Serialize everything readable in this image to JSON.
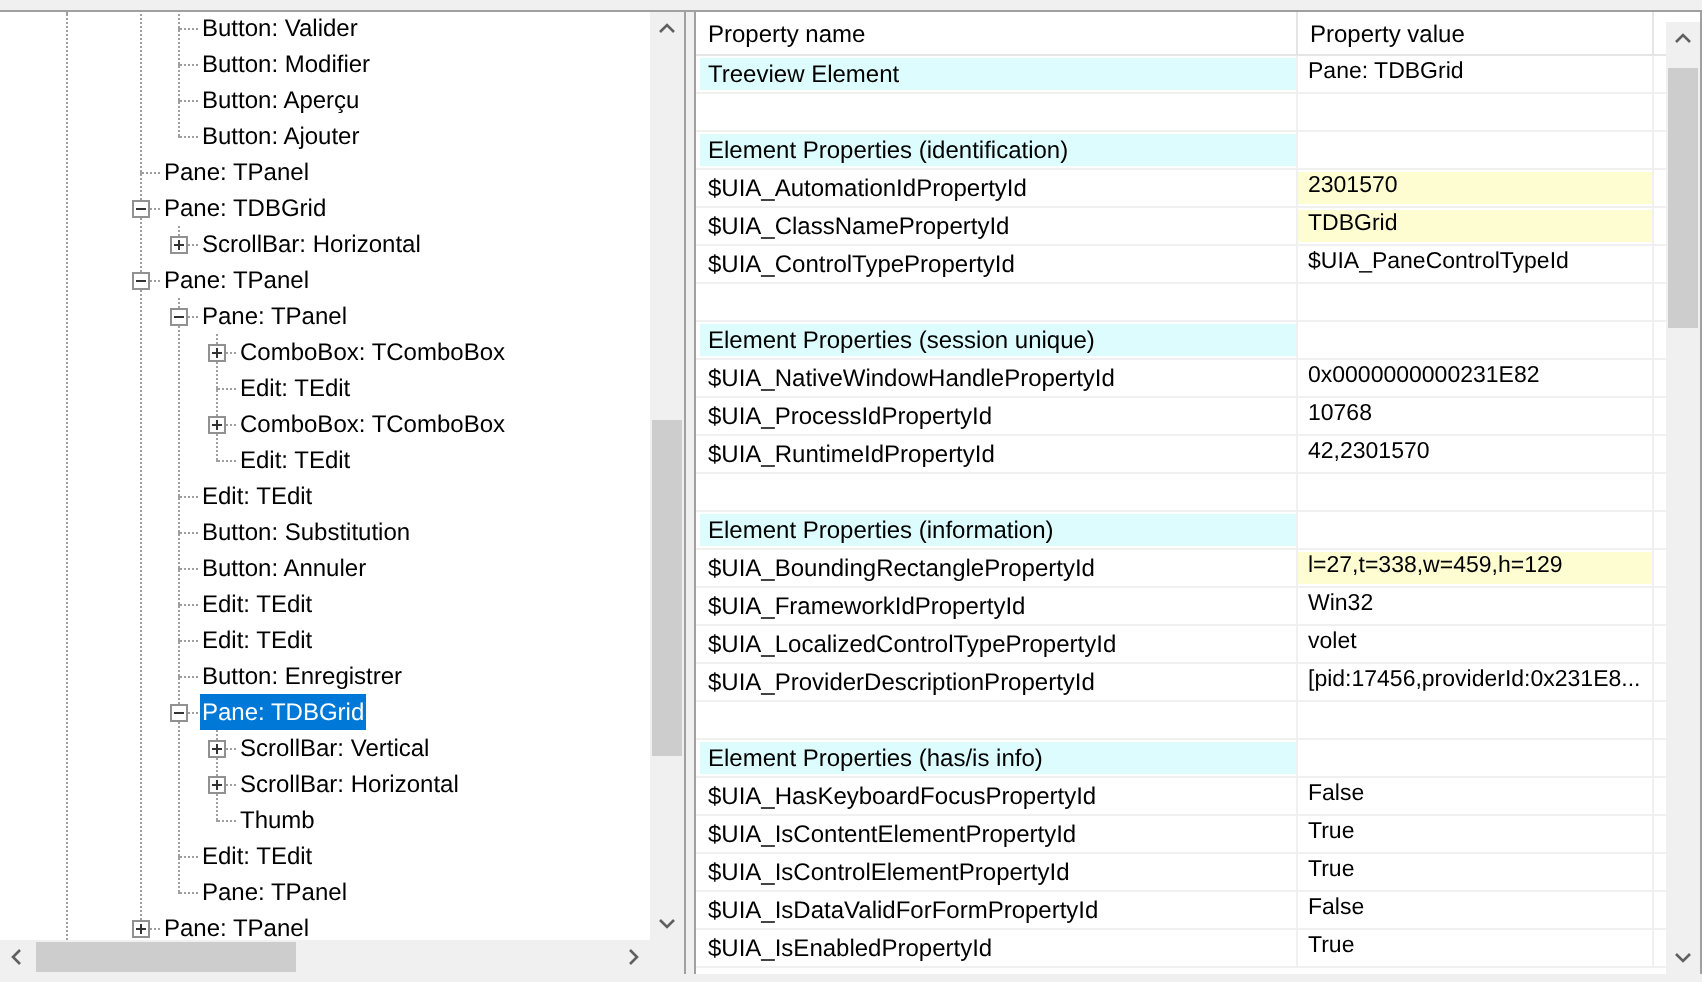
{
  "tree": {
    "items": [
      {
        "children": [
          {
            "label": "Button: Valider"
          },
          {
            "label": "Button: Modifier"
          },
          {
            "label": "Button: Aperçu"
          },
          {
            "label": "Button: Ajouter"
          }
        ]
      },
      {
        "label": "Pane: TPanel"
      },
      {
        "label": "Pane: TDBGrid",
        "expanded": true,
        "children": [
          {
            "label": "ScrollBar: Horizontal",
            "expanded": false
          }
        ]
      },
      {
        "label": "Pane: TPanel",
        "expanded": true,
        "children": [
          {
            "label": "Pane: TPanel",
            "expanded": true,
            "children": [
              {
                "label": "ComboBox: TComboBox",
                "expanded": false
              },
              {
                "label": "Edit: TEdit"
              },
              {
                "label": "ComboBox: TComboBox",
                "expanded": false
              },
              {
                "label": "Edit: TEdit"
              }
            ]
          },
          {
            "label": "Edit: TEdit"
          },
          {
            "label": "Button: Substitution"
          },
          {
            "label": "Button: Annuler"
          },
          {
            "label": "Edit: TEdit"
          },
          {
            "label": "Edit: TEdit"
          },
          {
            "label": "Button: Enregistrer"
          },
          {
            "label": "Pane: TDBGrid",
            "expanded": true,
            "selected": true,
            "children": [
              {
                "label": "ScrollBar: Vertical",
                "expanded": false
              },
              {
                "label": "ScrollBar: Horizontal",
                "expanded": false
              },
              {
                "label": "Thumb"
              }
            ]
          },
          {
            "label": "Edit: TEdit"
          },
          {
            "label": "Pane: TPanel"
          }
        ]
      },
      {
        "label": "Pane: TPanel",
        "expanded": false
      }
    ]
  },
  "properties": {
    "columns": [
      "Property name",
      "Property value"
    ],
    "rows": [
      {
        "kind": "element",
        "name": "Treeview Element",
        "value": "Pane: TDBGrid"
      },
      {
        "kind": "blank"
      },
      {
        "kind": "section",
        "name": "Element Properties (identification)"
      },
      {
        "kind": "property",
        "name": "$UIA_AutomationIdPropertyId",
        "value": "2301570",
        "highlighted": true
      },
      {
        "kind": "property",
        "name": "$UIA_ClassNamePropertyId",
        "value": "TDBGrid",
        "highlighted": true
      },
      {
        "kind": "property",
        "name": "$UIA_ControlTypePropertyId",
        "value": "$UIA_PaneControlTypeId",
        "highlighted": false
      },
      {
        "kind": "blank"
      },
      {
        "kind": "section",
        "name": "Element Properties (session unique)"
      },
      {
        "kind": "property",
        "name": "$UIA_NativeWindowHandlePropertyId",
        "value": "0x0000000000231E82",
        "highlighted": false
      },
      {
        "kind": "property",
        "name": "$UIA_ProcessIdPropertyId",
        "value": "10768",
        "highlighted": false
      },
      {
        "kind": "property",
        "name": "$UIA_RuntimeIdPropertyId",
        "value": "42,2301570",
        "highlighted": false
      },
      {
        "kind": "blank"
      },
      {
        "kind": "section",
        "name": "Element Properties (information)"
      },
      {
        "kind": "property",
        "name": "$UIA_BoundingRectanglePropertyId",
        "value": "l=27,t=338,w=459,h=129",
        "highlighted": true
      },
      {
        "kind": "property",
        "name": "$UIA_FrameworkIdPropertyId",
        "value": "Win32",
        "highlighted": false
      },
      {
        "kind": "property",
        "name": "$UIA_LocalizedControlTypePropertyId",
        "value": "volet",
        "highlighted": false
      },
      {
        "kind": "property",
        "name": "$UIA_ProviderDescriptionPropertyId",
        "value": "[pid:17456,providerId:0x231E8...",
        "highlighted": false
      },
      {
        "kind": "blank"
      },
      {
        "kind": "section",
        "name": "Element Properties (has/is info)"
      },
      {
        "kind": "property",
        "name": "$UIA_HasKeyboardFocusPropertyId",
        "value": "False",
        "highlighted": false
      },
      {
        "kind": "property",
        "name": "$UIA_IsContentElementPropertyId",
        "value": "True",
        "highlighted": false
      },
      {
        "kind": "property",
        "name": "$UIA_IsControlElementPropertyId",
        "value": "True",
        "highlighted": false
      },
      {
        "kind": "property",
        "name": "$UIA_IsDataValidForFormPropertyId",
        "value": "False",
        "highlighted": false
      },
      {
        "kind": "property",
        "name": "$UIA_IsEnabledPropertyId",
        "value": "True",
        "highlighted": false
      }
    ]
  }
}
